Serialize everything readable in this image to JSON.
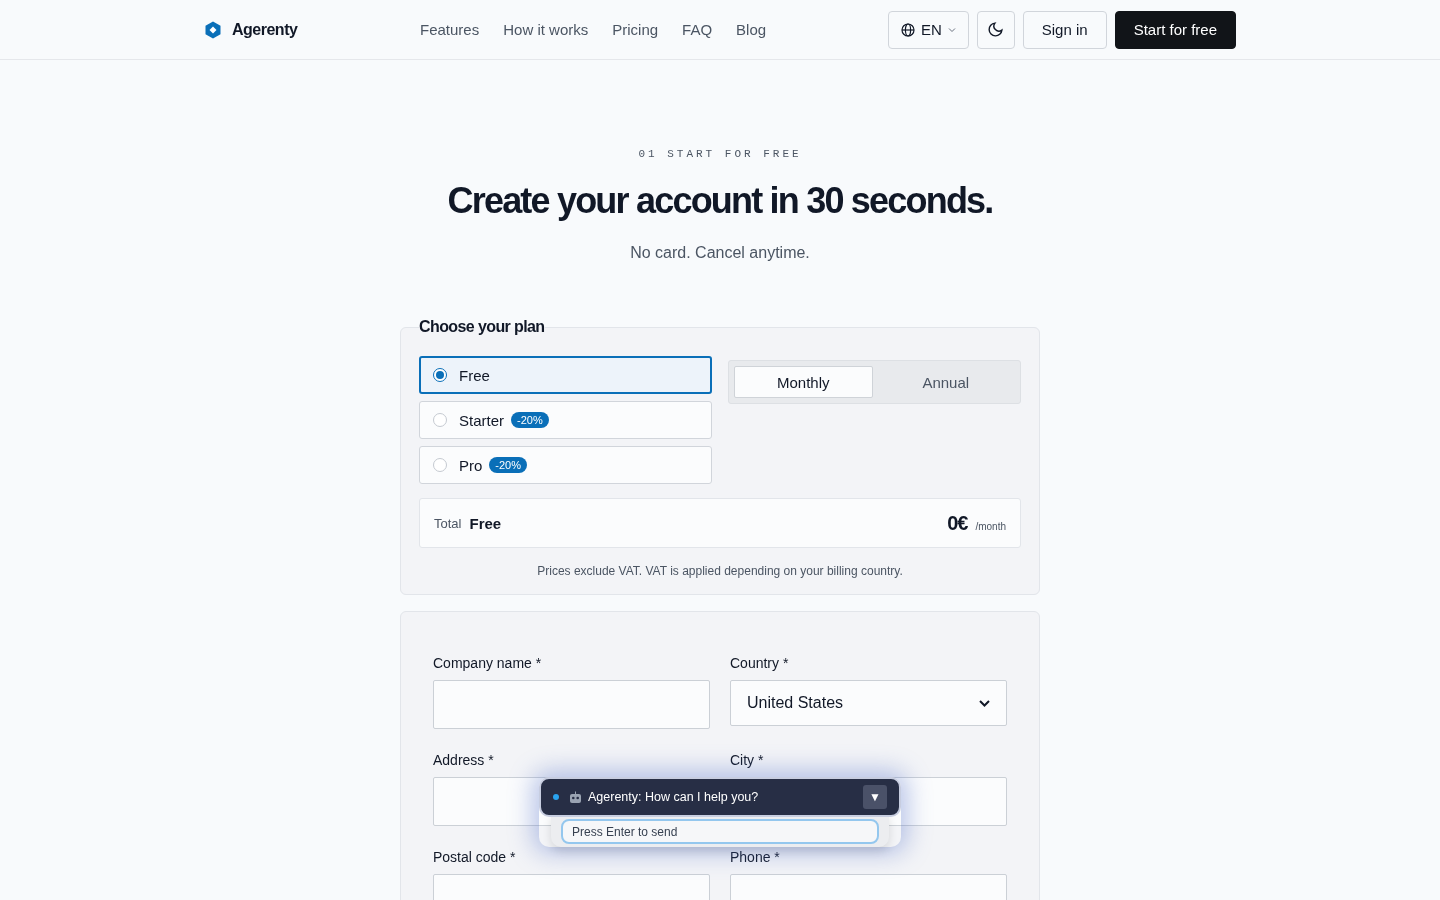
{
  "nav": {
    "brand": "Agerenty",
    "links": [
      "Features",
      "How it works",
      "Pricing",
      "FAQ",
      "Blog"
    ],
    "language": "EN",
    "sign_in": "Sign in",
    "cta": "Start for free"
  },
  "hero": {
    "eyebrow": "01 START FOR FREE",
    "title": "Create your account in 30 seconds.",
    "subtitle": "No card. Cancel anytime."
  },
  "plan": {
    "legend": "Choose your plan",
    "plans": [
      {
        "name": "Free",
        "selected": true
      },
      {
        "name": "Starter",
        "badge": "-20%",
        "selected": false
      },
      {
        "name": "Pro",
        "badge": "-20%",
        "selected": false
      }
    ],
    "billing": [
      {
        "label": "Monthly",
        "selected": true
      },
      {
        "label": "Annual",
        "selected": false
      }
    ],
    "total_label": "Total",
    "total_plan": "Free",
    "price": "0€",
    "period": "/month",
    "note": "Prices exclude VAT. VAT is applied depending on your billing country."
  },
  "form": {
    "fields": [
      {
        "label": "Company name *",
        "kind": "text"
      },
      {
        "label": "Country *",
        "kind": "select",
        "value": "United States"
      },
      {
        "label": "Address *",
        "kind": "text"
      },
      {
        "label": "City *",
        "kind": "text"
      },
      {
        "label": "Postal code *",
        "kind": "text"
      },
      {
        "label": "Phone *",
        "kind": "text"
      }
    ]
  },
  "chat": {
    "title": "Agerenty: How can I help you?",
    "toggle": "▼",
    "placeholder": "Press Enter to send"
  }
}
